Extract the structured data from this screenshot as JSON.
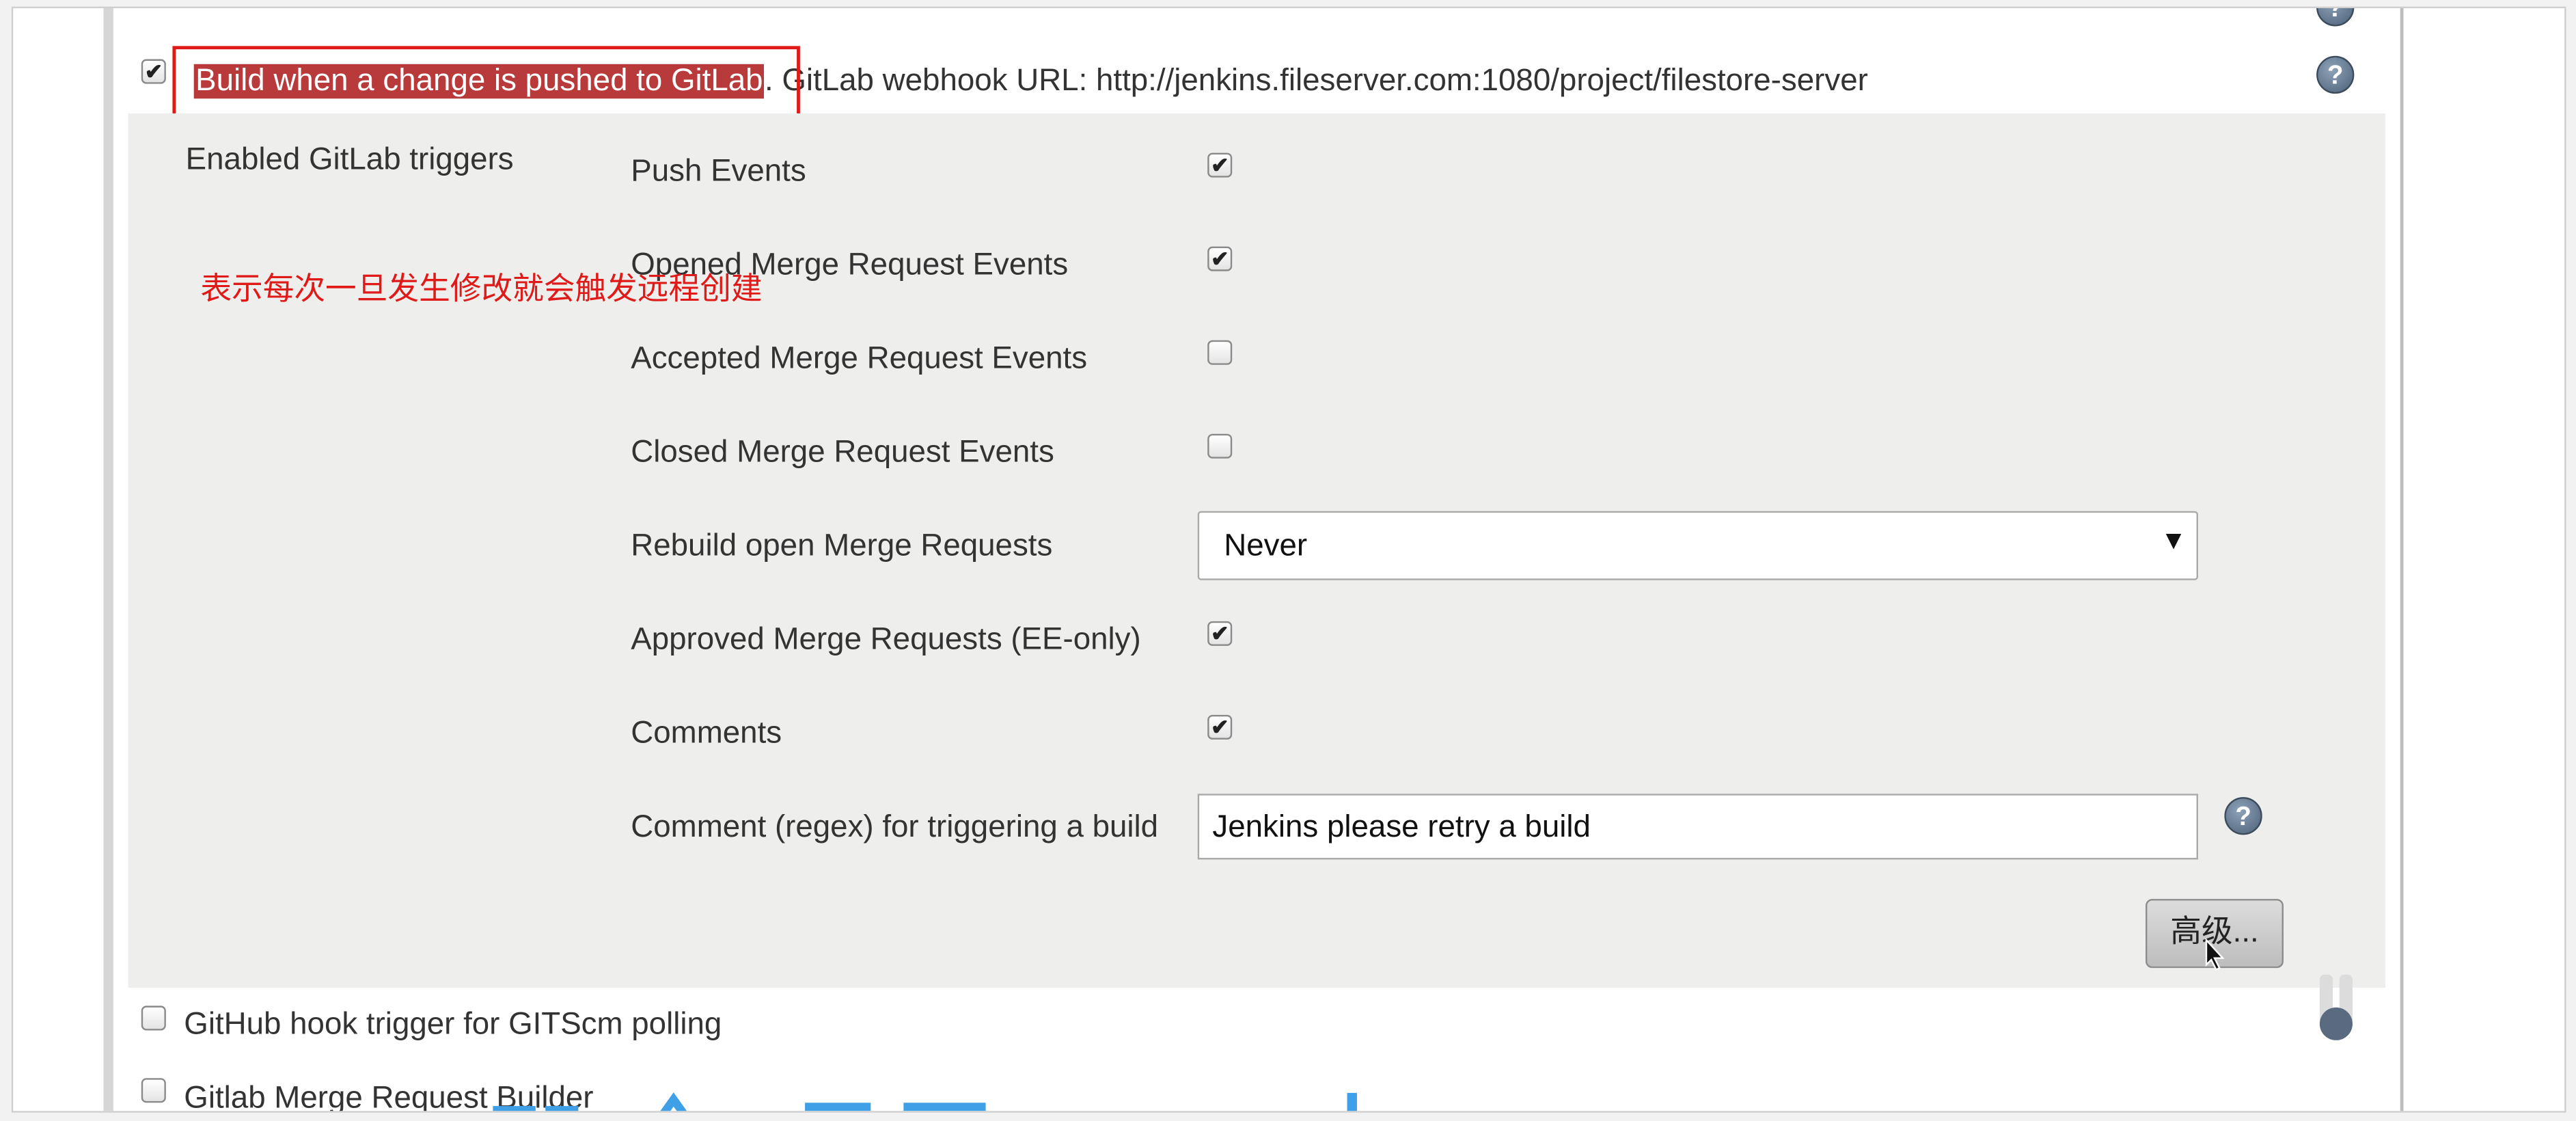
{
  "section_heading": "",
  "gitlab_trigger": {
    "checked": true,
    "title": "Build when a change is pushed to GitLab",
    "url_text": ". GitLab webhook URL: http://jenkins.fileserver.com:1080/project/filestore-server"
  },
  "annotation": "表示每次一旦发生修改就会触发远程创建",
  "enabled_triggers_label": "Enabled GitLab triggers",
  "triggers": [
    {
      "label": "Push Events",
      "checked": true
    },
    {
      "label": "Opened Merge Request Events",
      "checked": true
    },
    {
      "label": "Accepted Merge Request Events",
      "checked": false
    },
    {
      "label": "Closed Merge Request Events",
      "checked": false
    }
  ],
  "rebuild": {
    "label": "Rebuild open Merge Requests",
    "value": "Never",
    "arrow": "▼"
  },
  "approved": {
    "label": "Approved Merge Requests (EE-only)",
    "checked": true
  },
  "comments": {
    "label": "Comments",
    "checked": true
  },
  "comment_regex": {
    "label": "Comment (regex) for triggering a build",
    "value": "Jenkins please retry a build"
  },
  "advanced_button": "高级...",
  "github_hook": {
    "label": "GitHub hook trigger for GITScm polling",
    "checked": false
  },
  "gitlab_mr_builder": {
    "label": "Gitlab Merge Request Builder",
    "checked": false
  },
  "help_glyph": "?",
  "check_glyph": "✔",
  "icons": [
    "help-icon",
    "checkbox-icon",
    "cursor-icon",
    "dropdown-arrow-icon"
  ],
  "colors": {
    "highlight": "#b83a3a",
    "annotation": "#e01919",
    "panel": "#eeefec"
  }
}
